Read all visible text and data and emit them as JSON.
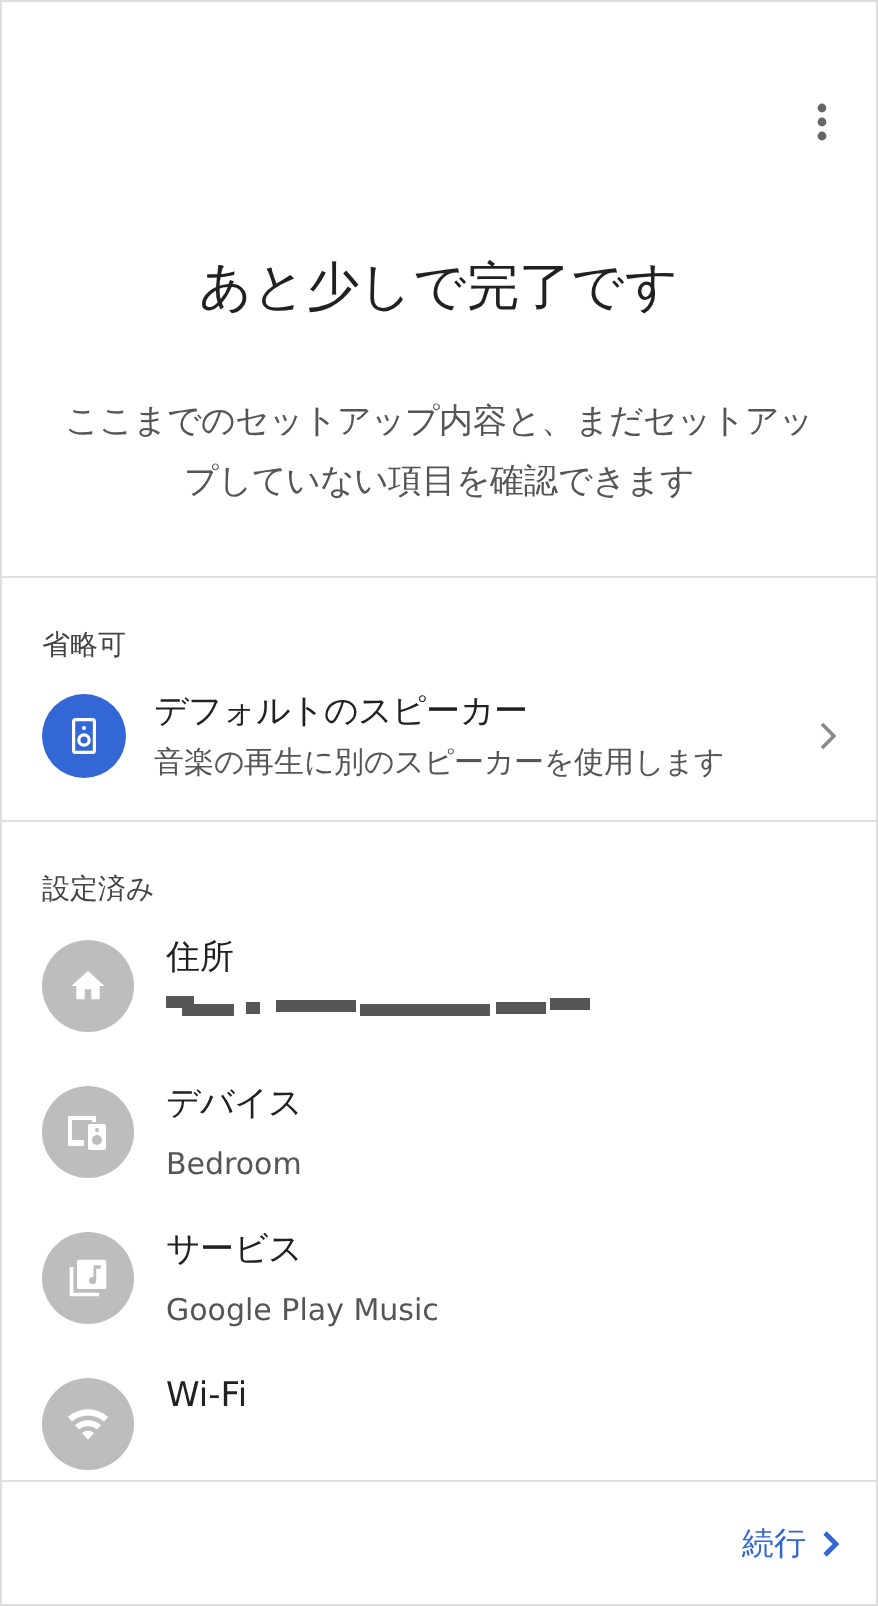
{
  "header": {
    "title": "あと少しで完了です",
    "description": "ここまでのセットアップ内容と、まだセットアップしていない項目を確認できます"
  },
  "optional": {
    "heading": "省略可",
    "items": [
      {
        "title": "デフォルトのスピーカー",
        "subtitle": "音楽の再生に別のスピーカーを使用します"
      }
    ]
  },
  "done": {
    "heading": "設定済み",
    "items": [
      {
        "title": "住所",
        "redacted": true
      },
      {
        "title": "デバイス",
        "subtitle": "Bedroom",
        "redacted": false
      },
      {
        "title": "サービス",
        "subtitle": "Google Play Music",
        "redacted": false
      },
      {
        "title": "Wi-Fi",
        "redacted": false
      }
    ]
  },
  "footer": {
    "next": "続行"
  }
}
